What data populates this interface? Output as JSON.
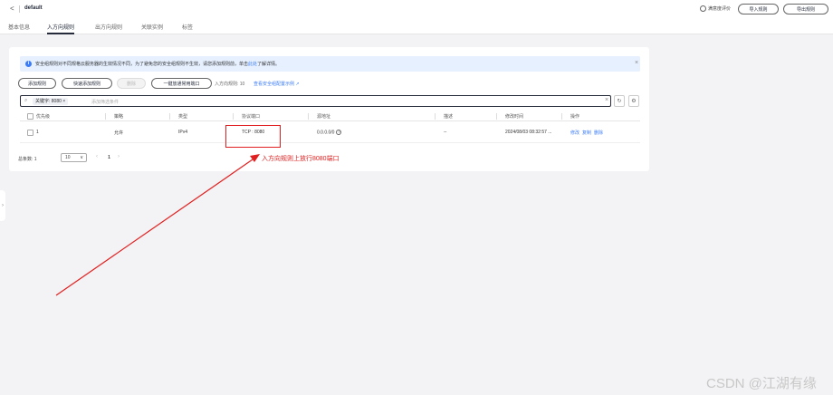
{
  "header": {
    "back_glyph": "<",
    "breadcrumb": "default",
    "feedback": "满意度评价",
    "import_button": "导入规则",
    "export_button": "导出规则"
  },
  "tabs": [
    {
      "label": "基本信息",
      "active": false
    },
    {
      "label": "入方向规则",
      "active": true
    },
    {
      "label": "出方向规则",
      "active": false
    },
    {
      "label": "关联实例",
      "active": false
    },
    {
      "label": "标签",
      "active": false
    }
  ],
  "notice": {
    "text": "安全组规则对不同规格云服务器的生效情况不同，为了避免您的安全组规则不生效，请您添加规则前，单击",
    "link": "此处",
    "text_after": "了解详情。"
  },
  "toolbar": {
    "add_rule": "添加规则",
    "quick_add": "快速添加规则",
    "delete": "删除",
    "one_click": "一键放通常用端口",
    "rule_count": "入方向规则: 10",
    "howto_link": "查看安全组配置示例"
  },
  "filter": {
    "chip": "关键字: 8080",
    "placeholder": "添加筛选条件"
  },
  "table": {
    "columns": [
      "优先级",
      "策略",
      "类型",
      "协议端口",
      "源地址",
      "描述",
      "修改时间",
      "操作"
    ],
    "rows": [
      {
        "priority": "1",
        "policy": "允许",
        "type": "IPv4",
        "protocol_port": "TCP : 8080",
        "source": "0.0.0.0/0",
        "description": "--",
        "modified": "2024/08/03 08:32:57 ...",
        "actions": [
          "修改",
          "复制",
          "删除"
        ]
      }
    ]
  },
  "pagination": {
    "total": "总条数: 1",
    "page_size": "10",
    "current_page": "1"
  },
  "annotation": "入方向规则上放行8080端口",
  "watermark": "CSDN @江湖有缘",
  "colors": {
    "accent": "#3b7cf6",
    "annotation": "#e02020"
  }
}
